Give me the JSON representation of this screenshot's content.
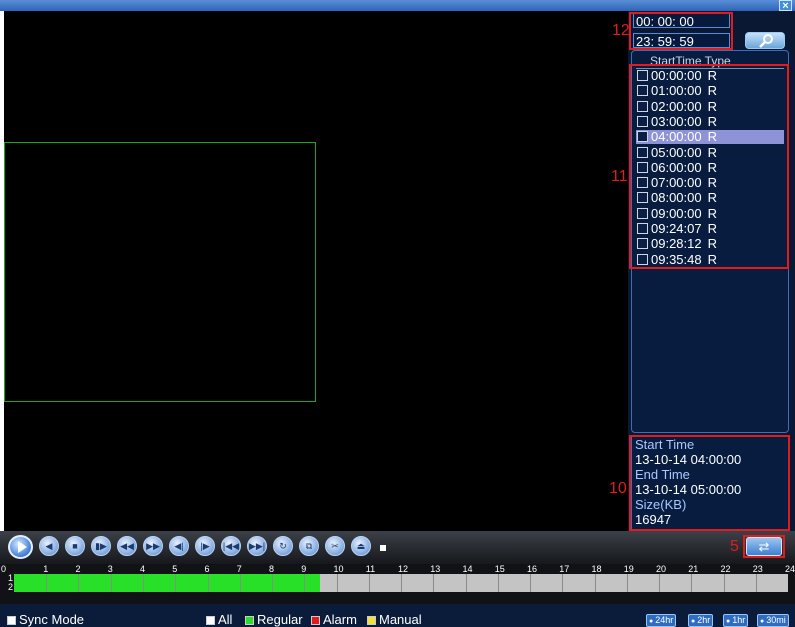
{
  "window": {
    "close_label": "×"
  },
  "search": {
    "start_time": "00: 00: 00",
    "end_time": "23: 59: 59"
  },
  "annotations": {
    "n12": "12",
    "n11": "11",
    "n10": "10",
    "n5": "5"
  },
  "file_list": {
    "header": "StartTime Type",
    "items": [
      {
        "time": "00:00:00",
        "type": "R",
        "selected": false
      },
      {
        "time": "01:00:00",
        "type": "R",
        "selected": false
      },
      {
        "time": "02:00:00",
        "type": "R",
        "selected": false
      },
      {
        "time": "03:00:00",
        "type": "R",
        "selected": false
      },
      {
        "time": "04:00:00",
        "type": "R",
        "selected": true
      },
      {
        "time": "05:00:00",
        "type": "R",
        "selected": false
      },
      {
        "time": "06:00:00",
        "type": "R",
        "selected": false
      },
      {
        "time": "07:00:00",
        "type": "R",
        "selected": false
      },
      {
        "time": "08:00:00",
        "type": "R",
        "selected": false
      },
      {
        "time": "09:00:00",
        "type": "R",
        "selected": false
      },
      {
        "time": "09:24:07",
        "type": "R",
        "selected": false
      },
      {
        "time": "09:28:12",
        "type": "R",
        "selected": false
      },
      {
        "time": "09:35:48",
        "type": "R",
        "selected": false
      }
    ]
  },
  "file_info": {
    "start_label": "Start Time",
    "start_value": "13-10-14 04:00:00",
    "end_label": "End Time",
    "end_value": "13-10-14 05:00:00",
    "size_label": "Size(KB)",
    "size_value": "16947"
  },
  "controls": {
    "buttons": [
      "reverse-play",
      "stop",
      "slow",
      "fast-backward",
      "fast-forward",
      "previous-frame",
      "next-frame",
      "previous-file",
      "next-file",
      "loop",
      "fullscreen",
      "clip",
      "backup"
    ],
    "refresh_glyph": "⇄"
  },
  "timeline": {
    "hours": [
      "0",
      "1",
      "2",
      "3",
      "4",
      "5",
      "6",
      "7",
      "8",
      "9",
      "10",
      "11",
      "12",
      "13",
      "14",
      "15",
      "16",
      "17",
      "18",
      "19",
      "20",
      "21",
      "22",
      "23",
      "24"
    ],
    "channels": [
      "1",
      "2"
    ],
    "recorded_until_hour": 9.5,
    "colors": {
      "recorded": "#28e028",
      "empty": "#c4c4c4"
    }
  },
  "bottom": {
    "sync_mode": "Sync Mode",
    "filters": [
      {
        "label": "All",
        "color": "#ffffff"
      },
      {
        "label": "Regular",
        "color": "#28e028"
      },
      {
        "label": "Alarm",
        "color": "#e21c1c"
      },
      {
        "label": "Manual",
        "color": "#f2e23a"
      }
    ],
    "zoom": [
      "24hr",
      "2hr",
      "1hr",
      "30mi"
    ]
  }
}
